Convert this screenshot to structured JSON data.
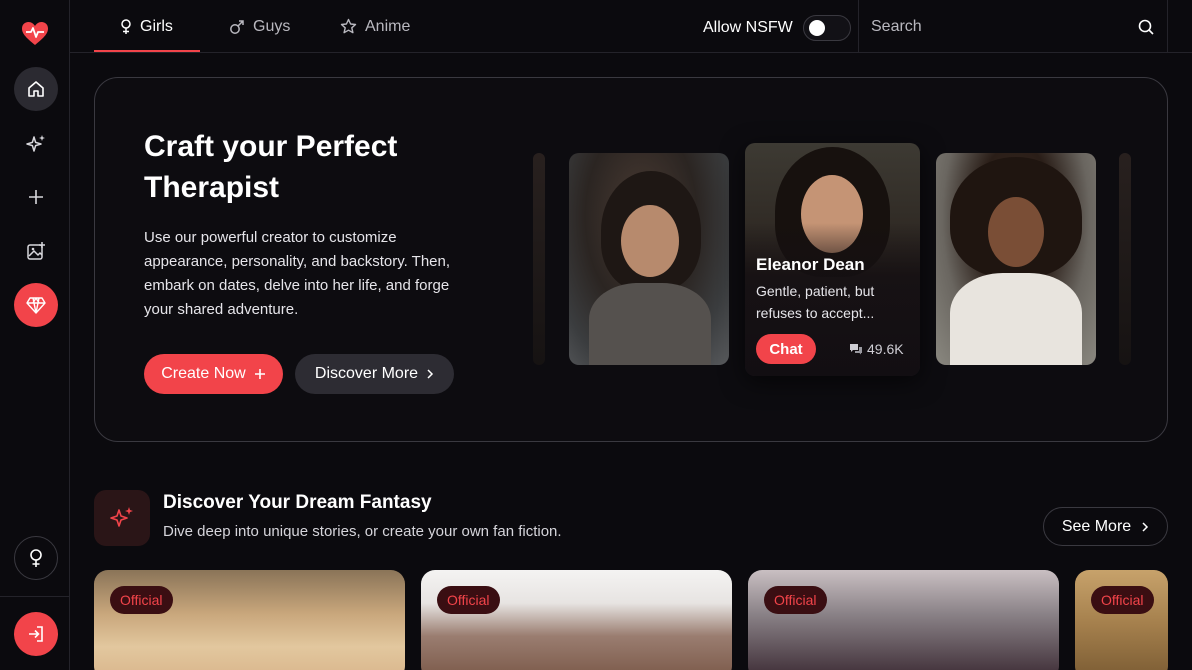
{
  "nav": {
    "tabs": [
      {
        "label": "Girls",
        "icon": "female-icon",
        "active": true
      },
      {
        "label": "Guys",
        "icon": "male-icon",
        "active": false
      },
      {
        "label": "Anime",
        "icon": "star-icon",
        "active": false
      }
    ],
    "nsfw_label": "Allow NSFW",
    "nsfw_enabled": false,
    "search_placeholder": "Search"
  },
  "sidebar": {
    "items": [
      {
        "icon": "home-icon",
        "active": true
      },
      {
        "icon": "sparkles-icon"
      },
      {
        "icon": "plus-icon"
      },
      {
        "icon": "image-plus-icon"
      },
      {
        "icon": "diamond-icon",
        "highlight": true
      }
    ],
    "bottom": [
      {
        "icon": "female-icon"
      },
      {
        "icon": "login-icon"
      }
    ]
  },
  "hero": {
    "title": "Craft your Perfect Therapist",
    "description": "Use our powerful creator to customize appearance, personality, and backstory. Then, embark on dates, delve into her life, and forge your shared adventure.",
    "create_label": "Create Now",
    "discover_label": "Discover More",
    "featured": {
      "name": "Eleanor Dean",
      "description": "Gentle, patient, but refuses to accept...",
      "chat_label": "Chat",
      "count": "49.6K"
    }
  },
  "section": {
    "title": "Discover Your Dream Fantasy",
    "subtitle": "Dive deep into unique stories, or create your own fan fiction.",
    "see_more_label": "See More",
    "cards": [
      {
        "badge": "Official"
      },
      {
        "badge": "Official"
      },
      {
        "badge": "Official"
      },
      {
        "badge": "Official"
      }
    ]
  },
  "colors": {
    "accent": "#f2444a",
    "background": "#0b0a0e",
    "border": "#3a3940"
  }
}
